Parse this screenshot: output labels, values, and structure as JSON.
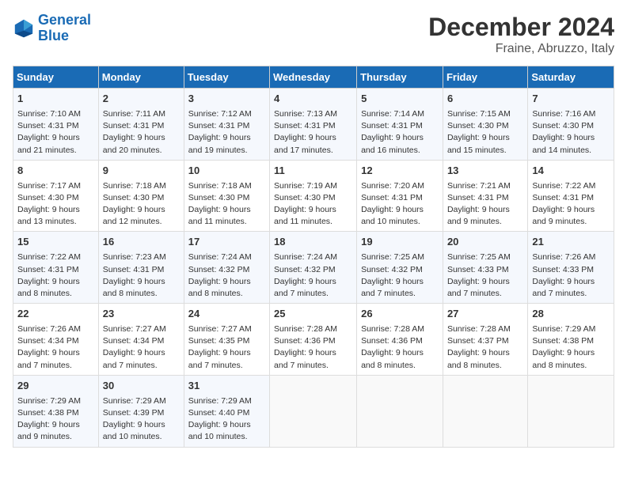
{
  "logo": {
    "line1": "General",
    "line2": "Blue"
  },
  "title": "December 2024",
  "location": "Fraine, Abruzzo, Italy",
  "days_of_week": [
    "Sunday",
    "Monday",
    "Tuesday",
    "Wednesday",
    "Thursday",
    "Friday",
    "Saturday"
  ],
  "weeks": [
    [
      {
        "day": "1",
        "rise": "Sunrise: 7:10 AM",
        "set": "Sunset: 4:31 PM",
        "daylight": "Daylight: 9 hours and 21 minutes."
      },
      {
        "day": "2",
        "rise": "Sunrise: 7:11 AM",
        "set": "Sunset: 4:31 PM",
        "daylight": "Daylight: 9 hours and 20 minutes."
      },
      {
        "day": "3",
        "rise": "Sunrise: 7:12 AM",
        "set": "Sunset: 4:31 PM",
        "daylight": "Daylight: 9 hours and 19 minutes."
      },
      {
        "day": "4",
        "rise": "Sunrise: 7:13 AM",
        "set": "Sunset: 4:31 PM",
        "daylight": "Daylight: 9 hours and 17 minutes."
      },
      {
        "day": "5",
        "rise": "Sunrise: 7:14 AM",
        "set": "Sunset: 4:31 PM",
        "daylight": "Daylight: 9 hours and 16 minutes."
      },
      {
        "day": "6",
        "rise": "Sunrise: 7:15 AM",
        "set": "Sunset: 4:30 PM",
        "daylight": "Daylight: 9 hours and 15 minutes."
      },
      {
        "day": "7",
        "rise": "Sunrise: 7:16 AM",
        "set": "Sunset: 4:30 PM",
        "daylight": "Daylight: 9 hours and 14 minutes."
      }
    ],
    [
      {
        "day": "8",
        "rise": "Sunrise: 7:17 AM",
        "set": "Sunset: 4:30 PM",
        "daylight": "Daylight: 9 hours and 13 minutes."
      },
      {
        "day": "9",
        "rise": "Sunrise: 7:18 AM",
        "set": "Sunset: 4:30 PM",
        "daylight": "Daylight: 9 hours and 12 minutes."
      },
      {
        "day": "10",
        "rise": "Sunrise: 7:18 AM",
        "set": "Sunset: 4:30 PM",
        "daylight": "Daylight: 9 hours and 11 minutes."
      },
      {
        "day": "11",
        "rise": "Sunrise: 7:19 AM",
        "set": "Sunset: 4:30 PM",
        "daylight": "Daylight: 9 hours and 11 minutes."
      },
      {
        "day": "12",
        "rise": "Sunrise: 7:20 AM",
        "set": "Sunset: 4:31 PM",
        "daylight": "Daylight: 9 hours and 10 minutes."
      },
      {
        "day": "13",
        "rise": "Sunrise: 7:21 AM",
        "set": "Sunset: 4:31 PM",
        "daylight": "Daylight: 9 hours and 9 minutes."
      },
      {
        "day": "14",
        "rise": "Sunrise: 7:22 AM",
        "set": "Sunset: 4:31 PM",
        "daylight": "Daylight: 9 hours and 9 minutes."
      }
    ],
    [
      {
        "day": "15",
        "rise": "Sunrise: 7:22 AM",
        "set": "Sunset: 4:31 PM",
        "daylight": "Daylight: 9 hours and 8 minutes."
      },
      {
        "day": "16",
        "rise": "Sunrise: 7:23 AM",
        "set": "Sunset: 4:31 PM",
        "daylight": "Daylight: 9 hours and 8 minutes."
      },
      {
        "day": "17",
        "rise": "Sunrise: 7:24 AM",
        "set": "Sunset: 4:32 PM",
        "daylight": "Daylight: 9 hours and 8 minutes."
      },
      {
        "day": "18",
        "rise": "Sunrise: 7:24 AM",
        "set": "Sunset: 4:32 PM",
        "daylight": "Daylight: 9 hours and 7 minutes."
      },
      {
        "day": "19",
        "rise": "Sunrise: 7:25 AM",
        "set": "Sunset: 4:32 PM",
        "daylight": "Daylight: 9 hours and 7 minutes."
      },
      {
        "day": "20",
        "rise": "Sunrise: 7:25 AM",
        "set": "Sunset: 4:33 PM",
        "daylight": "Daylight: 9 hours and 7 minutes."
      },
      {
        "day": "21",
        "rise": "Sunrise: 7:26 AM",
        "set": "Sunset: 4:33 PM",
        "daylight": "Daylight: 9 hours and 7 minutes."
      }
    ],
    [
      {
        "day": "22",
        "rise": "Sunrise: 7:26 AM",
        "set": "Sunset: 4:34 PM",
        "daylight": "Daylight: 9 hours and 7 minutes."
      },
      {
        "day": "23",
        "rise": "Sunrise: 7:27 AM",
        "set": "Sunset: 4:34 PM",
        "daylight": "Daylight: 9 hours and 7 minutes."
      },
      {
        "day": "24",
        "rise": "Sunrise: 7:27 AM",
        "set": "Sunset: 4:35 PM",
        "daylight": "Daylight: 9 hours and 7 minutes."
      },
      {
        "day": "25",
        "rise": "Sunrise: 7:28 AM",
        "set": "Sunset: 4:36 PM",
        "daylight": "Daylight: 9 hours and 7 minutes."
      },
      {
        "day": "26",
        "rise": "Sunrise: 7:28 AM",
        "set": "Sunset: 4:36 PM",
        "daylight": "Daylight: 9 hours and 8 minutes."
      },
      {
        "day": "27",
        "rise": "Sunrise: 7:28 AM",
        "set": "Sunset: 4:37 PM",
        "daylight": "Daylight: 9 hours and 8 minutes."
      },
      {
        "day": "28",
        "rise": "Sunrise: 7:29 AM",
        "set": "Sunset: 4:38 PM",
        "daylight": "Daylight: 9 hours and 8 minutes."
      }
    ],
    [
      {
        "day": "29",
        "rise": "Sunrise: 7:29 AM",
        "set": "Sunset: 4:38 PM",
        "daylight": "Daylight: 9 hours and 9 minutes."
      },
      {
        "day": "30",
        "rise": "Sunrise: 7:29 AM",
        "set": "Sunset: 4:39 PM",
        "daylight": "Daylight: 9 hours and 10 minutes."
      },
      {
        "day": "31",
        "rise": "Sunrise: 7:29 AM",
        "set": "Sunset: 4:40 PM",
        "daylight": "Daylight: 9 hours and 10 minutes."
      },
      null,
      null,
      null,
      null
    ]
  ]
}
